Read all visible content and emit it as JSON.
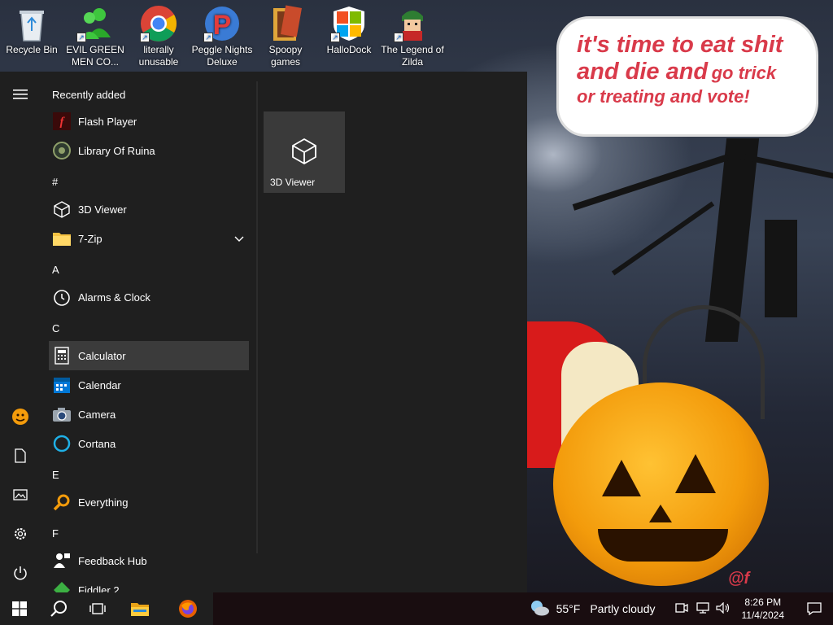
{
  "desktop": {
    "icons": [
      {
        "label": "Recycle Bin",
        "icon": "recycle-bin-icon",
        "shortcut": false
      },
      {
        "label": "EVIL GREEN MEN CO...",
        "icon": "people-icon",
        "shortcut": true
      },
      {
        "label": "literally unusable",
        "icon": "chrome-icon",
        "shortcut": true
      },
      {
        "label": "Peggle Nights Deluxe",
        "icon": "peggle-icon",
        "shortcut": true
      },
      {
        "label": "Spoopy games",
        "icon": "folder-icon",
        "shortcut": false
      },
      {
        "label": "HalloDock",
        "icon": "windows-logo-icon",
        "shortcut": true
      },
      {
        "label": "The Legend of Zilda",
        "icon": "game-character-icon",
        "shortcut": true
      }
    ]
  },
  "wallpaper": {
    "speech_bubble": {
      "line1": "it's time to eat shit",
      "line2a": "and die and",
      "line2b": "go trick",
      "line3": "or treating and vote!"
    },
    "signature": "@f"
  },
  "start_menu": {
    "recently_added_header": "Recently added",
    "recently_added": [
      {
        "label": "Flash Player",
        "icon": "flash-player-icon"
      },
      {
        "label": "Library Of Ruina",
        "icon": "library-of-ruina-icon"
      }
    ],
    "sections": [
      {
        "letter": "#",
        "items": [
          {
            "label": "3D Viewer",
            "icon": "3d-cube-icon",
            "expandable": false
          },
          {
            "label": "7-Zip",
            "icon": "folder-icon",
            "expandable": true
          }
        ]
      },
      {
        "letter": "A",
        "items": [
          {
            "label": "Alarms & Clock",
            "icon": "alarm-clock-icon",
            "expandable": false
          }
        ]
      },
      {
        "letter": "C",
        "items": [
          {
            "label": "Calculator",
            "icon": "calculator-icon",
            "expandable": false,
            "selected": true
          },
          {
            "label": "Calendar",
            "icon": "calendar-icon",
            "expandable": false
          },
          {
            "label": "Camera",
            "icon": "camera-icon",
            "expandable": false
          },
          {
            "label": "Cortana",
            "icon": "cortana-icon",
            "expandable": false
          }
        ]
      },
      {
        "letter": "E",
        "items": [
          {
            "label": "Everything",
            "icon": "magnifier-icon",
            "expandable": false
          }
        ]
      },
      {
        "letter": "F",
        "items": [
          {
            "label": "Feedback Hub",
            "icon": "feedback-hub-icon",
            "expandable": false
          },
          {
            "label": "Fiddler 2",
            "icon": "fiddler-icon",
            "expandable": false
          }
        ]
      }
    ],
    "tiles": [
      {
        "label": "3D Viewer",
        "icon": "3d-cube-icon"
      }
    ],
    "rail": [
      "hamburger-menu-icon",
      "user-avatar-icon",
      "documents-icon",
      "pictures-icon",
      "settings-gear-icon",
      "power-icon"
    ]
  },
  "taskbar": {
    "weather": {
      "temperature": "55°F",
      "condition": "Partly cloudy"
    },
    "clock": {
      "time": "8:26 PM",
      "date": "11/4/2024"
    },
    "pinned": [
      "start-windows-icon",
      "search-icon",
      "task-view-icon",
      "file-explorer-icon",
      "firefox-icon"
    ],
    "tray_icons": [
      "meet-now-icon",
      "network-icon",
      "volume-icon"
    ],
    "notification_icon": "notification-center-icon"
  }
}
